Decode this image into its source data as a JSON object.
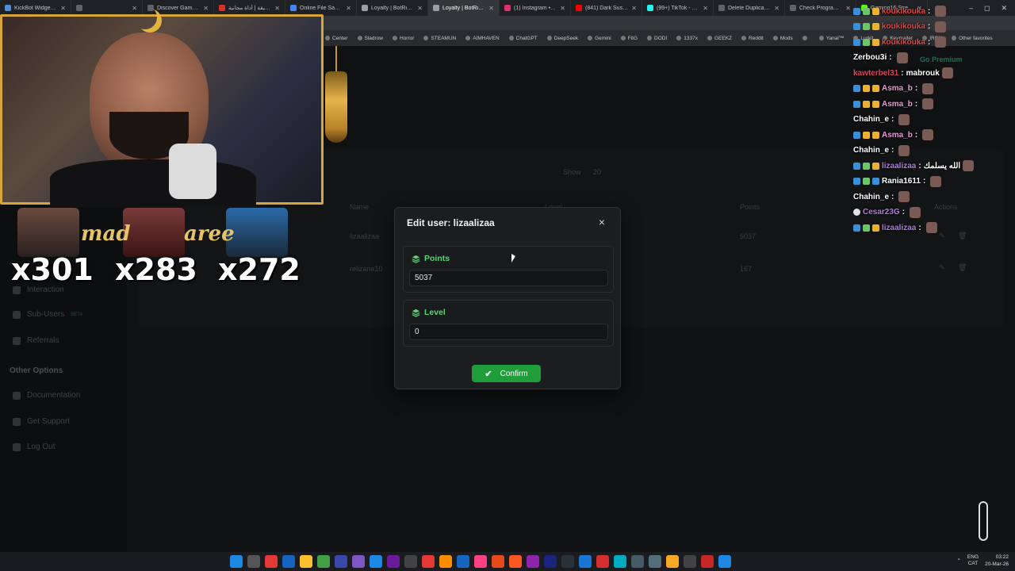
{
  "browser": {
    "tabs": [
      {
        "title": "KickBot Widget Library",
        "color": "#4a90d9"
      },
      {
        "title": "",
        "color": "#5f6368"
      },
      {
        "title": "Discover Games - Kar",
        "color": "#5f6368"
      },
      {
        "title": "مجلة العبقة | أداة مجانية",
        "color": "#d93025"
      },
      {
        "title": "Online File Sanyok",
        "color": "#4285f4"
      },
      {
        "title": "Loyalty | BotRix — Cla",
        "color": "#9aa0a6"
      },
      {
        "title": "Loyalty | BotRix — Clo",
        "color": "#9aa0a6"
      },
      {
        "title": "(1) Instagram • Messa",
        "color": "#e1306c"
      },
      {
        "title": "(841) Dark Suspen",
        "color": "#ff0000"
      },
      {
        "title": "(99+) TikTok - Make Yo",
        "color": "#25f4ee"
      },
      {
        "title": "Delete Duplicates",
        "color": "#5f6368"
      },
      {
        "title": "Check Program Disk S",
        "color": "#5f6368"
      },
      {
        "title": "Gaming16 Stream",
        "color": "#53fc18"
      }
    ],
    "active_tab": 6,
    "window_controls": [
      "–",
      "◻",
      "✕"
    ]
  },
  "bookmarks": [
    "Center",
    "Sladrow",
    "Horror",
    "STEAMUN",
    "AIMHAVEN",
    "ChatGPT",
    "DeepSeek",
    "Gemini",
    "FitG",
    "DODI",
    "1337x",
    "GEEKZ",
    "Reddit",
    "Mods",
    "",
    "Yanal™",
    "Lurkit",
    "Keymailer",
    "IROK",
    "Other favorites"
  ],
  "page": {
    "sidebar": {
      "items": [
        "Interaction",
        "Sub-Users",
        "Referrals"
      ],
      "beta_badge": "BETA",
      "section_title": "Other Options",
      "other_items": [
        "Documentation",
        "Get Support",
        "Log Out"
      ]
    },
    "show_label": "Show",
    "show_value": "20",
    "columns": [
      "Name",
      "Level",
      "Points",
      "Actions"
    ],
    "rows": [
      {
        "name": "lizaalizaa",
        "points": "5037"
      },
      {
        "name": "relizane10",
        "points": "167"
      }
    ]
  },
  "modal": {
    "title": "Edit user: lizaalizaa",
    "close_label": "×",
    "points_label": "Points",
    "points_value": "5037",
    "level_label": "Level",
    "level_value": "0",
    "confirm_label": "Confirm",
    "accent_color": "#1f9d3a"
  },
  "stream": {
    "banner_text_left": "mad",
    "banner_text_right": "aree",
    "multipliers": [
      "x301",
      "x283",
      "x272"
    ],
    "premium_label": "Go Premium"
  },
  "chat": [
    {
      "user": "koukikouka",
      "msg": "",
      "color": "#e04a4a",
      "badges": [
        "blue",
        "green",
        "gold"
      ]
    },
    {
      "user": "koukikouka",
      "msg": "",
      "color": "#e04a4a",
      "badges": [
        "blue",
        "green",
        "gold"
      ]
    },
    {
      "user": "koukikouka",
      "msg": "",
      "color": "#e04a4a",
      "badges": [
        "blue",
        "green",
        "gold"
      ]
    },
    {
      "user": "Zerbou3i",
      "msg": "",
      "color": "#ffffff",
      "badges": []
    },
    {
      "user": "kawterbel31",
      "msg": "mabrouk",
      "color": "#d8465a",
      "badges": []
    },
    {
      "user": "Asma_b",
      "msg": "",
      "color": "#e59ad6",
      "badges": [
        "blue",
        "gold",
        "gold"
      ]
    },
    {
      "user": "Asma_b",
      "msg": "",
      "color": "#e59ad6",
      "badges": [
        "blue",
        "gold",
        "gold"
      ]
    },
    {
      "user": "Chahin_e",
      "msg": "",
      "color": "#ffffff",
      "badges": []
    },
    {
      "user": "Asma_b",
      "msg": "",
      "color": "#e59ad6",
      "badges": [
        "blue",
        "gold",
        "gold"
      ]
    },
    {
      "user": "Chahin_e",
      "msg": "",
      "color": "#ffffff",
      "badges": []
    },
    {
      "user": "lizaalizaa",
      "msg": "الله يسلمك",
      "color": "#b07be0",
      "badges": [
        "blue",
        "green",
        "gold"
      ]
    },
    {
      "user": "Rania1611",
      "msg": "",
      "color": "#ffffff",
      "badges": [
        "blue",
        "green",
        "blue"
      ]
    },
    {
      "user": "Chahin_e",
      "msg": "",
      "color": "#ffffff",
      "badges": []
    },
    {
      "user": "Cesar23G",
      "msg": "",
      "color": "#b07be0",
      "badges": [
        "white"
      ]
    },
    {
      "user": "lizaalizaa",
      "msg": "",
      "color": "#b07be0",
      "badges": [
        "blue",
        "green",
        "gold"
      ]
    }
  ],
  "taskbar": {
    "lang_top": "ENG",
    "lang_bottom": "CAT",
    "time": "03:22",
    "date": "20-Mar-26"
  }
}
